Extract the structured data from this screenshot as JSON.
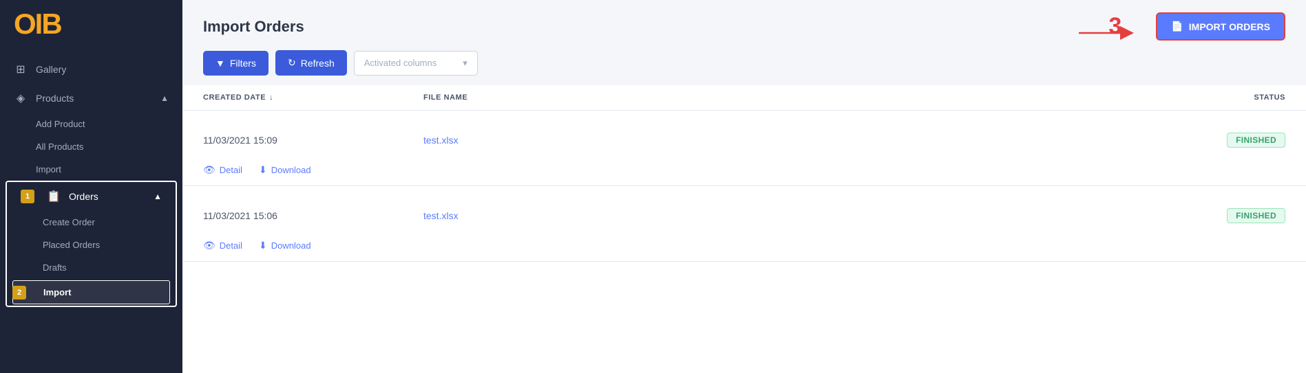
{
  "sidebar": {
    "logo": "OIB",
    "nav_items": [
      {
        "id": "gallery",
        "label": "Gallery",
        "icon": "🖼",
        "active": false
      },
      {
        "id": "products",
        "label": "Products",
        "icon": "📦",
        "active": false,
        "expanded": true
      },
      {
        "id": "add-product",
        "label": "Add Product",
        "sub": true,
        "active": false
      },
      {
        "id": "all-products",
        "label": "All Products",
        "sub": true,
        "active": false
      },
      {
        "id": "import-products",
        "label": "Import",
        "sub": true,
        "active": false
      },
      {
        "id": "orders",
        "label": "Orders",
        "icon": "📋",
        "active": true,
        "expanded": true
      },
      {
        "id": "create-order",
        "label": "Create Order",
        "sub": true,
        "active": false
      },
      {
        "id": "placed-orders",
        "label": "Placed Orders",
        "sub": true,
        "active": false
      },
      {
        "id": "drafts",
        "label": "Drafts",
        "sub": true,
        "active": false
      },
      {
        "id": "import-orders",
        "label": "Import",
        "sub": true,
        "active": true
      }
    ]
  },
  "header": {
    "title": "Import Orders",
    "import_btn_label": "IMPORT ORDERS"
  },
  "toolbar": {
    "filters_label": "Filters",
    "refresh_label": "Refresh",
    "columns_placeholder": "Activated columns"
  },
  "table": {
    "columns": [
      {
        "id": "created_date",
        "label": "CREATED DATE",
        "sortable": true
      },
      {
        "id": "file_name",
        "label": "FILE NAME"
      },
      {
        "id": "status",
        "label": "STATUS"
      }
    ],
    "rows": [
      {
        "id": 1,
        "created_date": "11/03/2021 15:09",
        "file_name": "test.xlsx",
        "status": "FINISHED",
        "detail_label": "Detail",
        "download_label": "Download"
      },
      {
        "id": 2,
        "created_date": "11/03/2021 15:06",
        "file_name": "test.xlsx",
        "status": "FINISHED",
        "detail_label": "Detail",
        "download_label": "Download"
      }
    ]
  },
  "annotations": {
    "marker1": "1",
    "marker2": "2",
    "marker3": "3"
  },
  "colors": {
    "sidebar_bg": "#1e2437",
    "accent_blue": "#3b5bdb",
    "accent_purple": "#5b7bff",
    "status_green_bg": "#e6f9f1",
    "status_green_text": "#38a169",
    "annotation_red": "#e53e3e",
    "annotation_gold": "#d4a017"
  }
}
